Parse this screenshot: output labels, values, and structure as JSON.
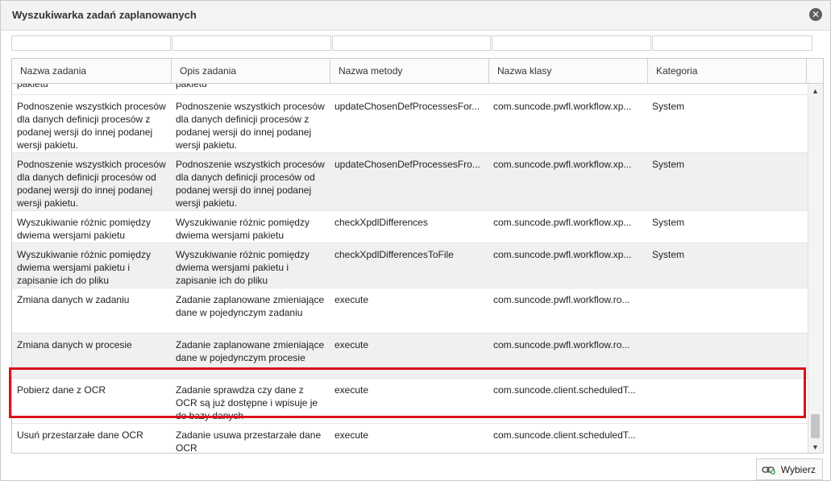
{
  "dialog": {
    "title": "Wyszukiwarka zadań zaplanowanych",
    "select_label": "Wybierz"
  },
  "grid": {
    "columns": [
      "Nazwa zadania",
      "Opis zadania",
      "Nazwa metody",
      "Nazwa klasy",
      "Kategoria"
    ],
    "rows": [
      {
        "name": "pakietu",
        "desc": "pakietu",
        "method": "",
        "klass": "",
        "category": ""
      },
      {
        "name": "Podnoszenie wszystkich procesów dla danych definicji procesów z podanej wersji do innej podanej wersji pakietu.",
        "desc": "Podnoszenie wszystkich procesów dla danych definicji procesów z podanej wersji do innej podanej wersji pakietu.",
        "method": "updateChosenDefProcessesFor...",
        "klass": "com.suncode.pwfl.workflow.xp...",
        "category": "System"
      },
      {
        "name": "Podnoszenie wszystkich procesów dla danych definicji procesów od podanej wersji do innej podanej wersji pakietu.",
        "desc": "Podnoszenie wszystkich procesów dla danych definicji procesów od podanej wersji do innej podanej wersji pakietu.",
        "method": "updateChosenDefProcessesFro...",
        "klass": "com.suncode.pwfl.workflow.xp...",
        "category": "System"
      },
      {
        "name": "Wyszukiwanie różnic pomiędzy dwiema wersjami pakietu",
        "desc": "Wyszukiwanie różnic pomiędzy dwiema wersjami pakietu",
        "method": "checkXpdlDifferences",
        "klass": "com.suncode.pwfl.workflow.xp...",
        "category": "System"
      },
      {
        "name": "Wyszukiwanie różnic pomiędzy dwiema wersjami pakietu i zapisanie ich do pliku",
        "desc": "Wyszukiwanie różnic pomiędzy dwiema wersjami pakietu i zapisanie ich do pliku",
        "method": "checkXpdlDifferencesToFile",
        "klass": "com.suncode.pwfl.workflow.xp...",
        "category": "System"
      },
      {
        "name": "Zmiana danych w zadaniu",
        "desc": "Zadanie zaplanowane zmieniające dane w pojedynczym zadaniu",
        "method": "execute",
        "klass": "com.suncode.pwfl.workflow.ro...",
        "category": ""
      },
      {
        "name": "Zmiana danych w procesie",
        "desc": "Zadanie zaplanowane zmieniające dane w pojedynczym procesie",
        "method": "execute",
        "klass": "com.suncode.pwfl.workflow.ro...",
        "category": ""
      },
      {
        "name": "Pobierz dane z OCR",
        "desc": "Zadanie sprawdza czy dane z OCR są już dostępne i wpisuje je do bazy danych",
        "method": "execute",
        "klass": "com.suncode.client.scheduledT...",
        "category": ""
      },
      {
        "name": "Usuń przestarzałe dane OCR",
        "desc": "Zadanie usuwa przestarzałe dane OCR",
        "method": "execute",
        "klass": "com.suncode.client.scheduledT...",
        "category": ""
      }
    ]
  },
  "colors": {
    "highlight": "#d9121b",
    "alt_row": "#f0f0f0"
  },
  "icons": {
    "close": "close-icon",
    "select": "link-icon"
  }
}
